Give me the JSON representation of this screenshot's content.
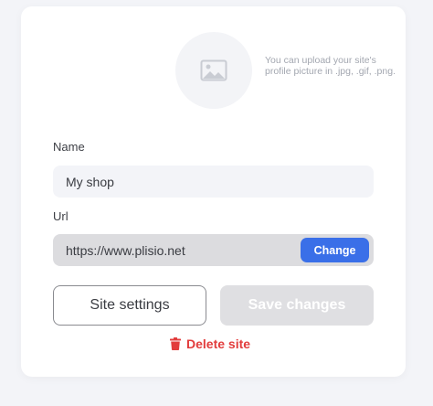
{
  "profile": {
    "upload_hint": "You can upload your site's profile picture in .jpg, .gif, .png.",
    "image_icon": "image-placeholder-icon"
  },
  "name_field": {
    "label": "Name",
    "value": "My shop"
  },
  "url_field": {
    "label": "Url",
    "value": "https://www.plisio.net",
    "change_label": "Change"
  },
  "actions": {
    "site_settings_label": "Site settings",
    "save_changes_label": "Save changes",
    "delete_label": "Delete site",
    "delete_icon": "trash-icon"
  },
  "colors": {
    "accent": "#3a6fe8",
    "danger": "#e23c3c",
    "disabled": "#dfdfe2"
  }
}
